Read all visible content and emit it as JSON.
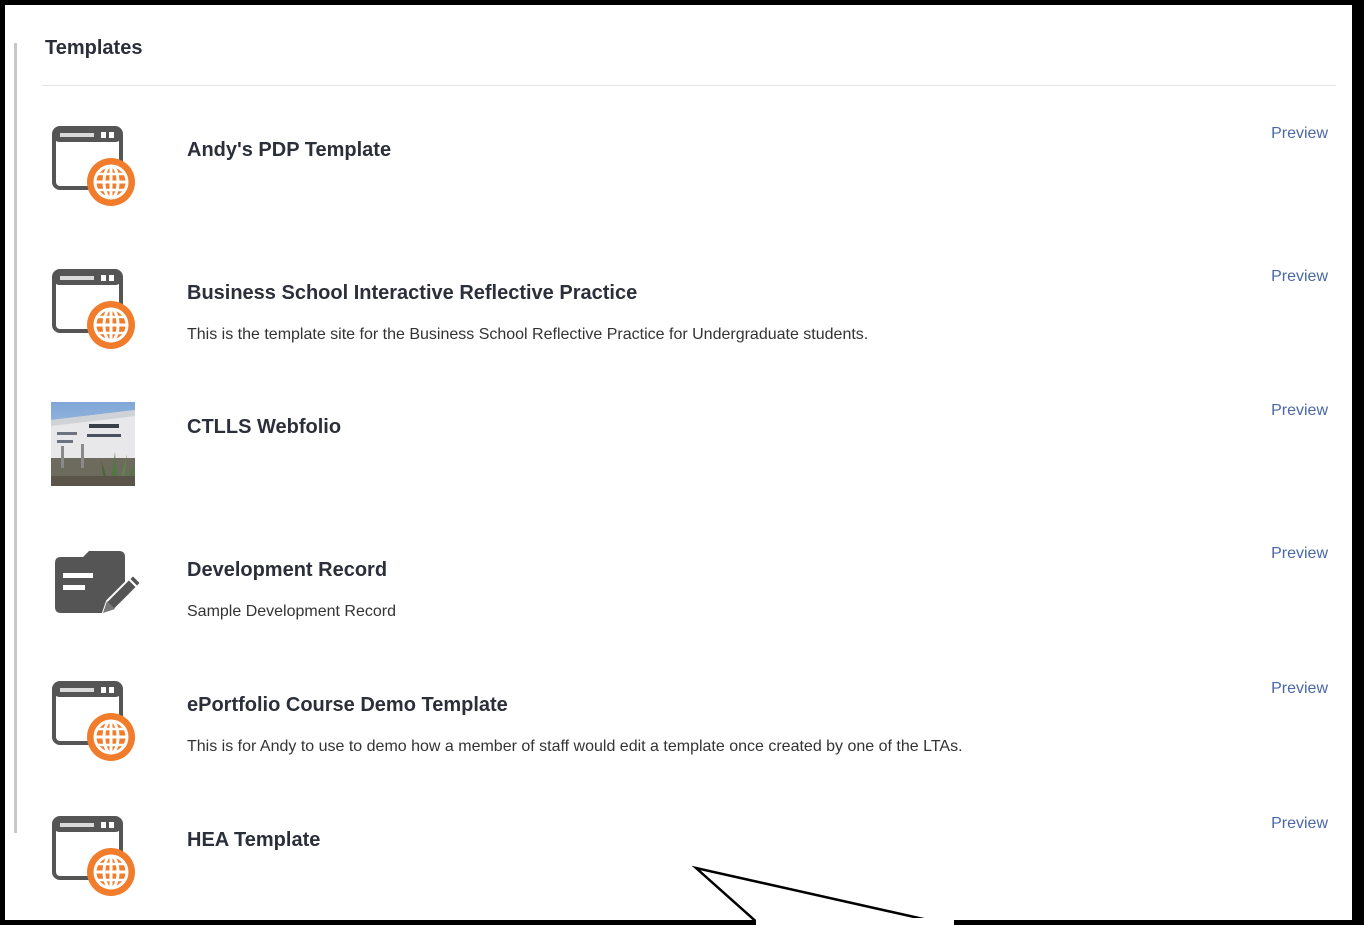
{
  "panel": {
    "title": "Templates"
  },
  "templates": [
    {
      "name": "Andy's PDP Template",
      "description": "",
      "icon": "web-template-icon",
      "preview_label": "Preview"
    },
    {
      "name": "Business School Interactive Reflective Practice",
      "description": "This is the template site for the Business School Reflective Practice for Undergraduate students.",
      "icon": "web-template-icon",
      "preview_label": "Preview"
    },
    {
      "name": "CTLLS Webfolio",
      "description": "",
      "icon": "building-photo-thumbnail",
      "preview_label": "Preview"
    },
    {
      "name": "Development Record",
      "description": "Sample Development Record",
      "icon": "edit-record-icon",
      "preview_label": "Preview"
    },
    {
      "name": "ePortfolio Course Demo Template",
      "description": "This is for Andy to use to demo how a member of staff would edit a template once created by one of the LTAs.",
      "icon": "web-template-icon",
      "preview_label": "Preview"
    },
    {
      "name": "HEA Template",
      "description": "",
      "icon": "web-template-icon",
      "preview_label": "Preview"
    }
  ],
  "colors": {
    "accent_orange": "#f07c2c",
    "icon_gray": "#555555",
    "link_blue": "#4a67a8",
    "title_text": "#2b2f3a"
  }
}
